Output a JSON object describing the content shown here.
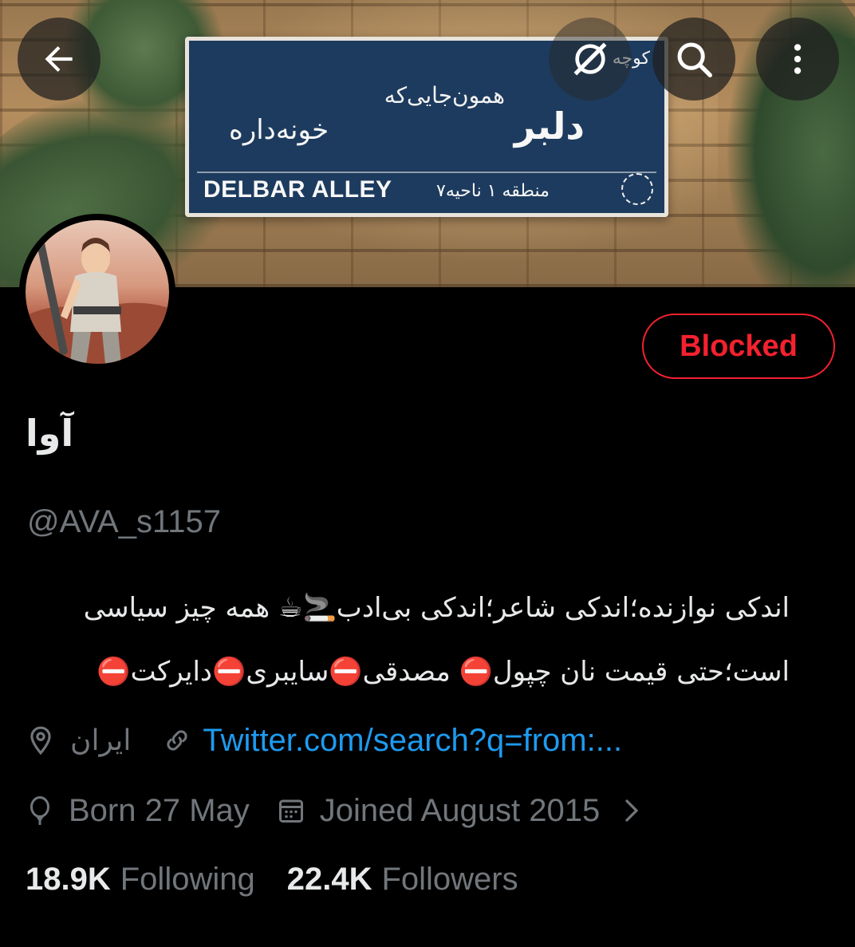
{
  "banner": {
    "sign_top": "کوچه",
    "sign_sub": "همون‌جایی‌که",
    "sign_main": "دلبر",
    "sign_main2": "خونه‌داره",
    "sign_english": "DELBAR ALLEY",
    "sign_district": "منطقه ۱ ناحیه۷"
  },
  "topbar": {
    "back_icon": "arrow-left-icon",
    "sync_icon": "sync-off-icon",
    "search_icon": "search-icon",
    "more_icon": "more-vertical-icon"
  },
  "profile": {
    "blocked_label": "Blocked",
    "display_name": "آوا",
    "handle": "@AVA_s1157",
    "bio_line1": "اندکی نوازنده؛اندکی شاعر؛اندکی بی‌ادب🚬☕ همه چیز سیاسی",
    "bio_line2": "است؛حتی قیمت نان چپول⛔ مصدقی⛔سایبری⛔دایرکت⛔",
    "location": "ایران",
    "link": "Twitter.com/search?q=from:...",
    "born": "Born 27 May",
    "joined": "Joined August 2015"
  },
  "stats": {
    "following_count": "18.9K",
    "following_label": "Following",
    "followers_count": "22.4K",
    "followers_label": "Followers"
  },
  "colors": {
    "background": "#000000",
    "text_primary": "#e7e9ea",
    "text_secondary": "#71767b",
    "link": "#1d9bf0",
    "blocked": "#f4212e"
  }
}
